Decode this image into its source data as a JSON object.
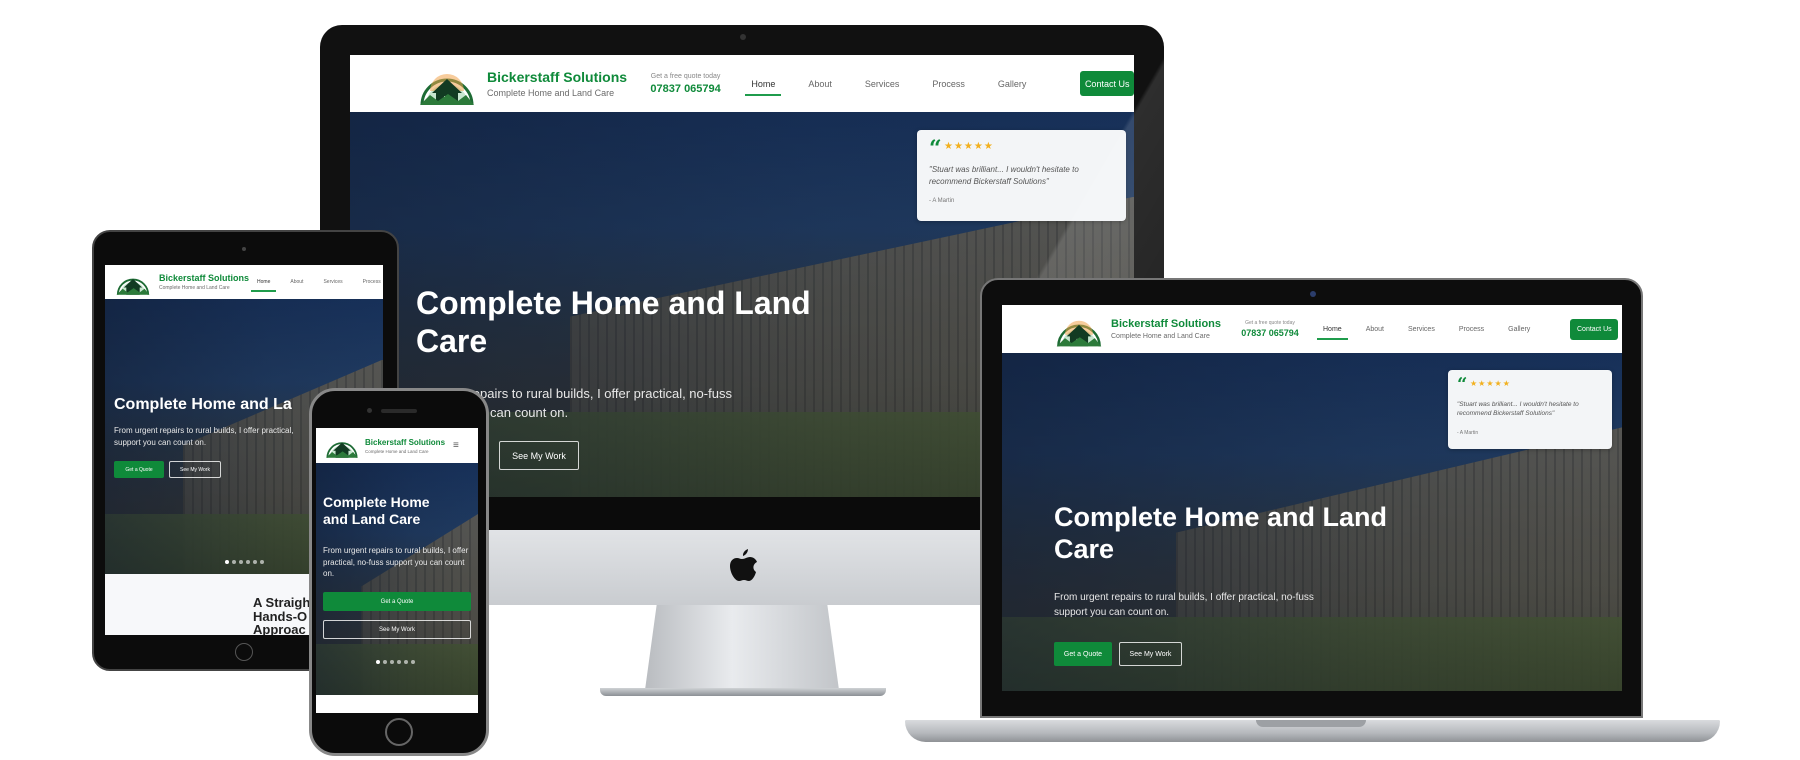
{
  "site": {
    "brand_name": "Bickerstaff Solutions",
    "brand_tagline": "Complete Home and Land Care",
    "quote_label": "Get a free quote today",
    "phone": "07837 065794",
    "nav": [
      "Home",
      "About",
      "Services",
      "Process",
      "Gallery"
    ],
    "contact_button": "Contact Us",
    "hero_title": "Complete Home and Land Care",
    "hero_subtitle": "From urgent repairs to rural builds, I offer practical, no-fuss support you can count on.",
    "cta_primary": "Get a Quote",
    "cta_secondary": "See My Work",
    "review": {
      "quote_mark": "“",
      "stars": "★★★★★",
      "text": "\"Stuart was brilliant... I wouldn't hesitate to recommend Bickerstaff Solutions\"",
      "author": "- A Martin"
    },
    "section_heading": "A Straightforward, Hands-On Approach"
  },
  "imac": {
    "hero_title_line1": "Complete Home and Land",
    "hero_title_line2": "Care",
    "hero_sub_fragment_1": "nt repairs to rural builds, I offer practical, no-fuss",
    "hero_sub_fragment_2": "can count on.",
    "apple_logo": "apple-icon"
  },
  "tablet": {
    "hero_title_fragment": "Complete Home and La",
    "hero_sub_line1": "From urgent repairs to rural builds, I offer practical,",
    "hero_sub_line2": "support you can count on.",
    "section_fragment_1": "A Straigh",
    "section_fragment_2": "Hands-O",
    "section_fragment_3": "Approac"
  },
  "phone": {
    "hero_title_line1": "Complete Home",
    "hero_title_line2": "and Land Care",
    "menu_icon": "hamburger-icon"
  },
  "carousel": {
    "dot_count": 6,
    "active_index": 0
  },
  "colors": {
    "brand_green": "#0f8a3a",
    "star_gold": "#f2b01e"
  }
}
